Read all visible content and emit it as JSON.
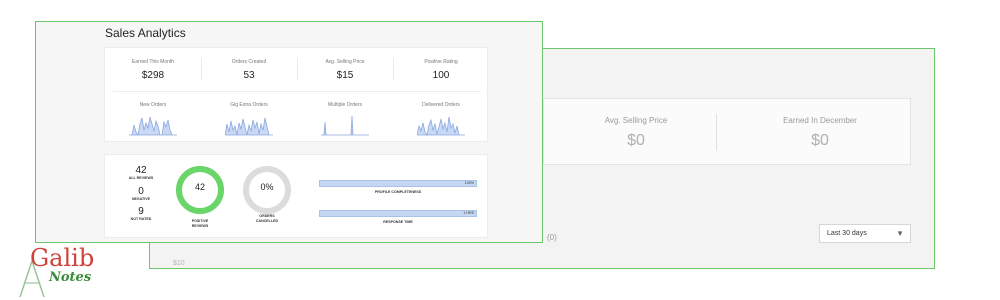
{
  "back_panel": {
    "stats": [
      {
        "label": "Avg. Selling Price",
        "value": "$0"
      },
      {
        "label": "Earned In December",
        "value": "$0"
      }
    ],
    "chart_count": "(0)",
    "range_select": {
      "value": "Last 30 days"
    },
    "y_axis_label": "$10"
  },
  "front_panel": {
    "title": "Sales Analytics",
    "stats": [
      {
        "label": "Earned This Month",
        "value": "$298"
      },
      {
        "label": "Orders Created",
        "value": "53"
      },
      {
        "label": "Avg. Selling Price",
        "value": "$15"
      },
      {
        "label": "Positive Rating",
        "value": "100"
      }
    ],
    "sparklines": [
      {
        "label": "New Orders"
      },
      {
        "label": "Gig Extra Orders"
      },
      {
        "label": "Multiple Orders"
      },
      {
        "label": "Delivered Orders"
      }
    ],
    "review_counts": [
      {
        "number": "42",
        "label": "ALL REVIEWS"
      },
      {
        "number": "0",
        "label": "NEGATIVE"
      },
      {
        "number": "9",
        "label": "NOT RATED"
      }
    ],
    "rings": [
      {
        "value": "42",
        "label_line1": "POSITIVE",
        "label_line2": "REVIEWS",
        "fill": 1.0,
        "color": "#6ad66a"
      },
      {
        "value": "0%",
        "label_line1": "ORDERS",
        "label_line2": "CANCELLED",
        "fill": 0.0,
        "color": "#6ad66a"
      }
    ],
    "bars": [
      {
        "value": "100%",
        "label": "PROFILE COMPLETENESS",
        "fill": 1.0
      },
      {
        "value": "1 HRS",
        "label": "RESPONSE TIME",
        "fill": 1.0
      }
    ]
  },
  "logo": {
    "line1": "Galib",
    "line2": "Notes"
  },
  "colors": {
    "panel_border": "#6cc76c",
    "ring_fill": "#6ad66a",
    "ring_track": "#dcdcdc",
    "spark_stroke": "#8aa8e0",
    "spark_fill": "#c9d8f4",
    "logo_red": "#d0413c",
    "logo_green": "#3c8b3c"
  }
}
